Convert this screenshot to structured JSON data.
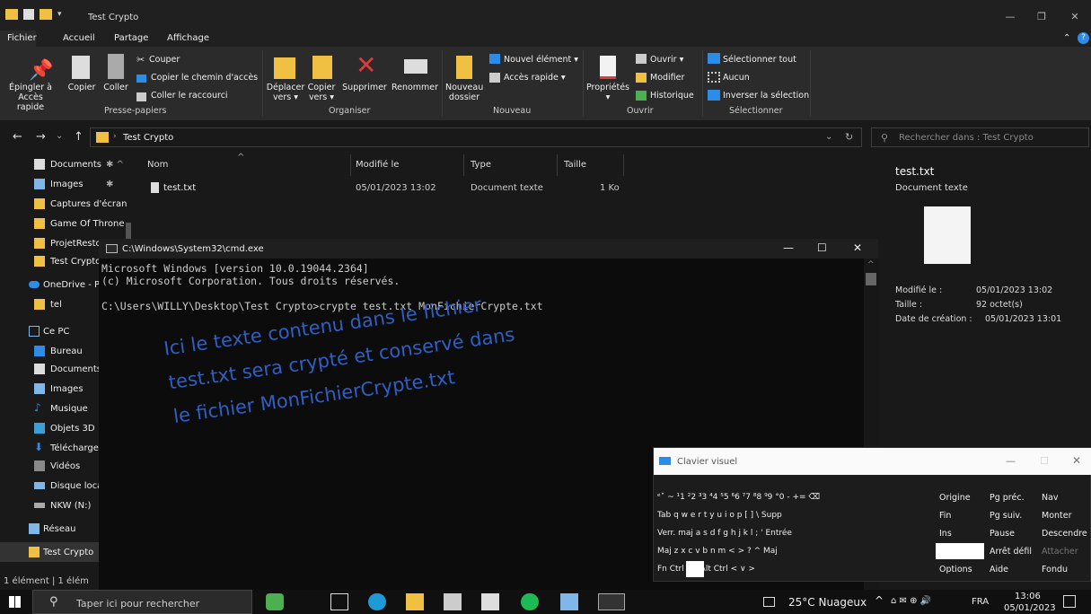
{
  "window": {
    "title": "Test Crypto"
  },
  "ribbon_tabs": [
    "Fichier",
    "Accueil",
    "Partage",
    "Affichage"
  ],
  "ribbon": {
    "epingler": "Épingler à",
    "epingler2": "Accès rapide",
    "copier": "Copier",
    "coller": "Coller",
    "couper": "Couper",
    "copier_chemin": "Copier le chemin d'accès",
    "coller_raccourci": "Coller le raccourci",
    "group_presse_papiers": "Presse-papiers",
    "deplacer": "Déplacer",
    "deplacer2": "vers ▾",
    "copier_vers": "Copier",
    "copier_vers2": "vers ▾",
    "supprimer": "Supprimer",
    "renommer": "Renommer",
    "group_organiser": "Organiser",
    "nouveau_dossier": "Nouveau",
    "nouveau_dossier2": "dossier",
    "nouvel_element": "Nouvel élément ▾",
    "acces_rapide": "Accès rapide ▾",
    "group_nouveau": "Nouveau",
    "proprietes": "Propriétés",
    "ouvrir": "Ouvrir ▾",
    "modifier": "Modifier",
    "historique": "Historique",
    "group_ouvrir": "Ouvrir",
    "selectionner_tout": "Sélectionner tout",
    "aucun": "Aucun",
    "inverser": "Inverser la sélection",
    "group_selectionner": "Sélectionner"
  },
  "address": {
    "path": "Test Crypto",
    "search_placeholder": "Rechercher dans : Test Crypto"
  },
  "nav": {
    "items": [
      "Documents",
      "Images",
      "Captures d'écran",
      "Game Of Throne",
      "ProjetResto",
      "Test Crypto",
      "OneDrive - Pe",
      "tel",
      "Ce PC",
      "Bureau",
      "Documents",
      "Images",
      "Musique",
      "Objets 3D",
      "Téléchargem",
      "Vidéos",
      "Disque local",
      "NKW (N:)",
      "Réseau",
      "Test Crypto"
    ]
  },
  "list": {
    "headers": [
      "Nom",
      "Modifié le",
      "Type",
      "Taille"
    ],
    "rows": [
      {
        "name": "test.txt",
        "modified": "05/01/2023 13:02",
        "type": "Document texte",
        "size": "1 Ko"
      }
    ]
  },
  "preview": {
    "filename": "test.txt",
    "filetype": "Document texte",
    "modified_label": "Modifié le :",
    "modified_value": "05/01/2023 13:02",
    "size_label": "Taille :",
    "size_value": "92 octet(s)",
    "created_label": "Date de création :",
    "created_value": "05/01/2023 13:01"
  },
  "status": "1 élément  |  1 élém",
  "cmd": {
    "title": "C:\\Windows\\System32\\cmd.exe",
    "line1": "Microsoft Windows [version 10.0.19044.2364]",
    "line2": "(c) Microsoft Corporation. Tous droits réservés.",
    "line3": "C:\\Users\\WILLY\\Desktop\\Test Crypto>crypte test.txt MonFichierCrypte.txt"
  },
  "annotation": {
    "line1": "Ici le texte contenu dans le fichier",
    "line2": "test.txt sera crypté et conservé dans",
    "line3": "le fichier MonFichierCrypte.txt"
  },
  "osk": {
    "title": "Clavier visuel",
    "row1": "ᵉ˟  ~  ¹1  ²2  ³3  ⁴4  ⁵5  ⁶6  ⁷7  ⁸8  ⁹9  °0  -  +=  ⌫",
    "row2": "Tab  q   w   e   r   t   y   u   i   o   p   [   ]   \\  Supp",
    "row3": "Verr. maj  a   s   d   f   g   h   j   k   l   ;   '    Entrée",
    "row4": "Maj        z   x   c   v   b   n   m   <   >   ?   ^   Maj",
    "row5": "Fn  Ctrl        Alt                                  Alt  Ctrl  <  ∨  >",
    "side_col1": [
      "Origine",
      "Fin",
      "Ins",
      "",
      "Options"
    ],
    "side_col2": [
      "Pg préc.",
      "Pg suiv.",
      "Pause",
      "Arrêt défil",
      "Aide"
    ],
    "side_col3": [
      "Nav",
      "Monter",
      "Descendre",
      "Attacher",
      "Fondu"
    ]
  },
  "taskbar": {
    "search_placeholder": "Taper ici pour rechercher",
    "weather": "25°C Nuageux",
    "lang": "FRA",
    "time": "13:06",
    "date": "05/01/2023"
  },
  "colors": {
    "folder": "#f0c043",
    "annotation": "#2f5fc4",
    "accent_blue": "#2d8ce6"
  }
}
